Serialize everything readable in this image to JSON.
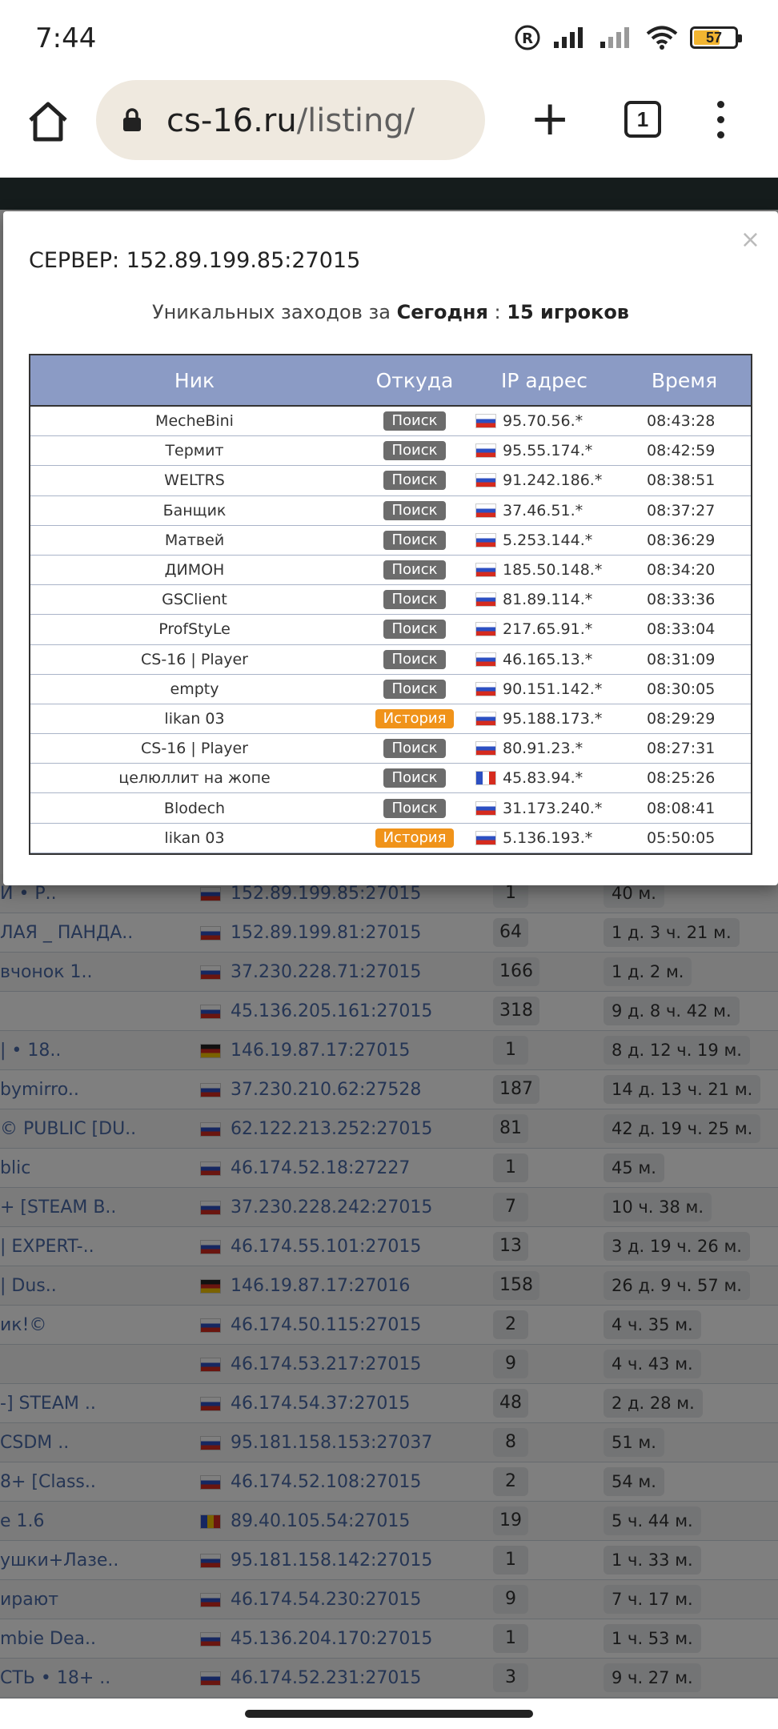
{
  "status": {
    "time": "7:44",
    "battery": "57"
  },
  "browser": {
    "url_host": "cs-16.ru",
    "url_path": "/listing/",
    "tabs_count": "1"
  },
  "modal": {
    "title": "СЕРВЕР: 152.89.199.85:27015",
    "subtitle_prefix": "Уникальных заходов за",
    "subtitle_period": "Сегодня",
    "subtitle_sep": ":",
    "subtitle_count": "15 игроков",
    "close": "×",
    "columns": [
      "Ник",
      "Откуда",
      "IP адрес",
      "Время"
    ],
    "rows": [
      {
        "nick": "MecheBini",
        "from": "Поиск",
        "from_type": "search",
        "flag": "ru",
        "ip": "95.70.56.*",
        "time": "08:43:28"
      },
      {
        "nick": "Термит",
        "from": "Поиск",
        "from_type": "search",
        "flag": "ru",
        "ip": "95.55.174.*",
        "time": "08:42:59"
      },
      {
        "nick": "WELTRS",
        "from": "Поиск",
        "from_type": "search",
        "flag": "ru",
        "ip": "91.242.186.*",
        "time": "08:38:51"
      },
      {
        "nick": "Банщик",
        "from": "Поиск",
        "from_type": "search",
        "flag": "ru",
        "ip": "37.46.51.*",
        "time": "08:37:27"
      },
      {
        "nick": "Матвей",
        "from": "Поиск",
        "from_type": "search",
        "flag": "ru",
        "ip": "5.253.144.*",
        "time": "08:36:29"
      },
      {
        "nick": "ДИМОН",
        "from": "Поиск",
        "from_type": "search",
        "flag": "ru",
        "ip": "185.50.148.*",
        "time": "08:34:20"
      },
      {
        "nick": "GSClient",
        "from": "Поиск",
        "from_type": "search",
        "flag": "ru",
        "ip": "81.89.114.*",
        "time": "08:33:36"
      },
      {
        "nick": "ProfStyLe",
        "from": "Поиск",
        "from_type": "search",
        "flag": "ru",
        "ip": "217.65.91.*",
        "time": "08:33:04"
      },
      {
        "nick": "CS-16 | Player",
        "from": "Поиск",
        "from_type": "search",
        "flag": "ru",
        "ip": "46.165.13.*",
        "time": "08:31:09"
      },
      {
        "nick": "empty",
        "from": "Поиск",
        "from_type": "search",
        "flag": "ru",
        "ip": "90.151.142.*",
        "time": "08:30:05"
      },
      {
        "nick": "likan 03",
        "from": "История",
        "from_type": "history",
        "flag": "ru",
        "ip": "95.188.173.*",
        "time": "08:29:29"
      },
      {
        "nick": "CS-16 | Player",
        "from": "Поиск",
        "from_type": "search",
        "flag": "ru",
        "ip": "80.91.23.*",
        "time": "08:27:31"
      },
      {
        "nick": "целюллит на жопе",
        "from": "Поиск",
        "from_type": "search",
        "flag": "fr",
        "ip": "45.83.94.*",
        "time": "08:25:26"
      },
      {
        "nick": "Blodech",
        "from": "Поиск",
        "from_type": "search",
        "flag": "ru",
        "ip": "31.173.240.*",
        "time": "08:08:41"
      },
      {
        "nick": "likan 03",
        "from": "История",
        "from_type": "history",
        "flag": "ru",
        "ip": "5.136.193.*",
        "time": "05:50:05"
      }
    ]
  },
  "listing": [
    {
      "name": "И • Р..",
      "flag": "ru",
      "ip": "152.89.199.85:27015",
      "count": "1",
      "time": "40 м."
    },
    {
      "name": "ЛАЯ _ ПАНДА..",
      "flag": "ru",
      "ip": "152.89.199.81:27015",
      "count": "64",
      "time": "1 д. 3 ч. 21 м."
    },
    {
      "name": "вчонок 1..",
      "flag": "ru",
      "ip": "37.230.228.71:27015",
      "count": "166",
      "time": "1 д. 2 м."
    },
    {
      "name": "",
      "flag": "ru",
      "ip": "45.136.205.161:27015",
      "count": "318",
      "time": "9 д. 8 ч. 42 м."
    },
    {
      "name": "| • 18..",
      "flag": "de",
      "ip": "146.19.87.17:27015",
      "count": "1",
      "time": "8 д. 12 ч. 19 м."
    },
    {
      "name": "bymirro..",
      "flag": "ru",
      "ip": "37.230.210.62:27528",
      "count": "187",
      "time": "14 д. 13 ч. 21 м."
    },
    {
      "name": "© PUBLIC [DU..",
      "flag": "ru",
      "ip": "62.122.213.252:27015",
      "count": "81",
      "time": "42 д. 19 ч. 25 м."
    },
    {
      "name": "blic",
      "flag": "ru",
      "ip": "46.174.52.18:27227",
      "count": "1",
      "time": "45 м."
    },
    {
      "name": "+ [STEAM B..",
      "flag": "ru",
      "ip": "37.230.228.242:27015",
      "count": "7",
      "time": "10 ч. 38 м."
    },
    {
      "name": "| EXPERT-..",
      "flag": "ru",
      "ip": "46.174.55.101:27015",
      "count": "13",
      "time": "3 д. 19 ч. 26 м."
    },
    {
      "name": "| Dus..",
      "flag": "de",
      "ip": "146.19.87.17:27016",
      "count": "158",
      "time": "26 д. 9 ч. 57 м."
    },
    {
      "name": "ик!©",
      "flag": "ru",
      "ip": "46.174.50.115:27015",
      "count": "2",
      "time": "4 ч. 35 м."
    },
    {
      "name": "",
      "flag": "ru",
      "ip": "46.174.53.217:27015",
      "count": "9",
      "time": "4 ч. 43 м."
    },
    {
      "name": "-] STEAM ..",
      "flag": "ru",
      "ip": "46.174.54.37:27015",
      "count": "48",
      "time": "2 д. 28 м."
    },
    {
      "name": "CSDM ..",
      "flag": "ru",
      "ip": "95.181.158.153:27037",
      "count": "8",
      "time": "51 м."
    },
    {
      "name": "8+ [Class..",
      "flag": "ru",
      "ip": "46.174.52.108:27015",
      "count": "2",
      "time": "54 м."
    },
    {
      "name": "e 1.6",
      "flag": "ro",
      "ip": "89.40.105.54:27015",
      "count": "19",
      "time": "5 ч. 44 м."
    },
    {
      "name": "ушки+Лазе..",
      "flag": "ru",
      "ip": "95.181.158.142:27015",
      "count": "1",
      "time": "1 ч. 33 м."
    },
    {
      "name": "ирают",
      "flag": "ru",
      "ip": "46.174.54.230:27015",
      "count": "9",
      "time": "7 ч. 17 м."
    },
    {
      "name": "mbie Dea..",
      "flag": "ru",
      "ip": "45.136.204.170:27015",
      "count": "1",
      "time": "1 ч. 53 м."
    },
    {
      "name": "СТЬ • 18+ ..",
      "flag": "ru",
      "ip": "46.174.52.231:27015",
      "count": "3",
      "time": "9 ч. 27 м."
    }
  ]
}
